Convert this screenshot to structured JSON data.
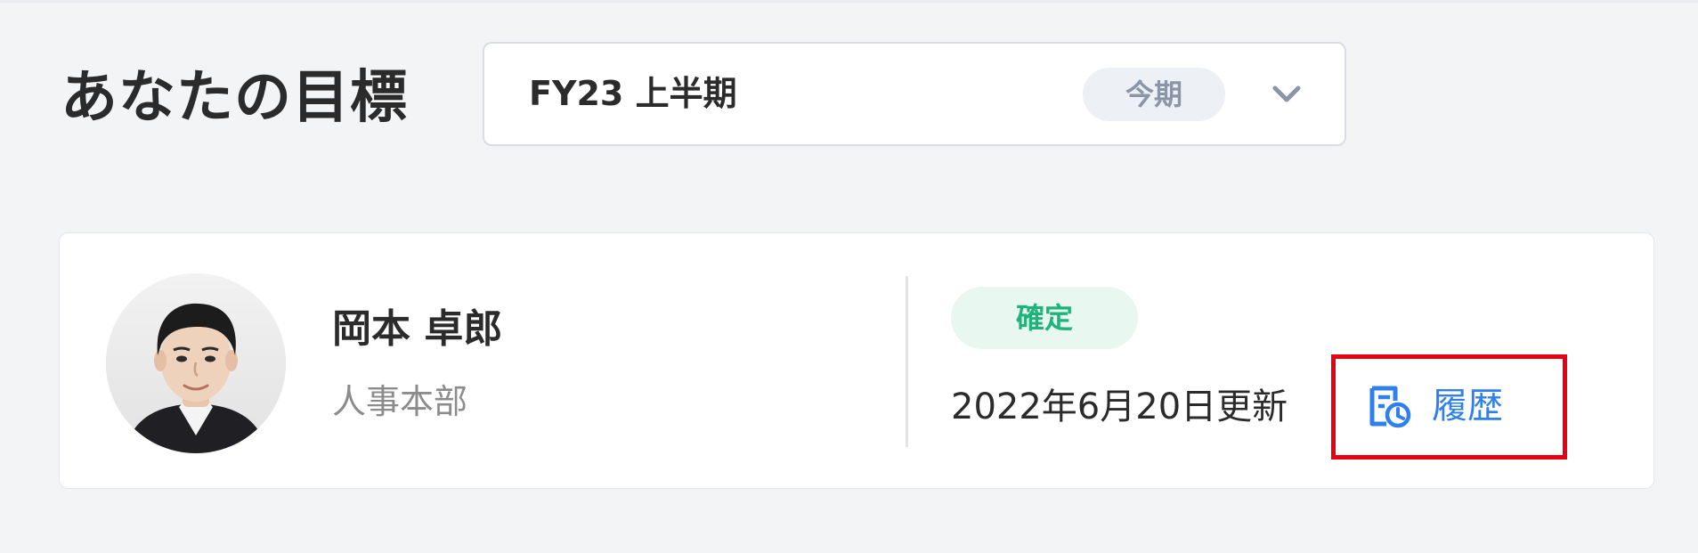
{
  "header": {
    "title": "あなたの目標",
    "period_select": {
      "selected_label": "FY23 上半期",
      "current_badge": "今期",
      "icon": "chevron-down-icon"
    }
  },
  "profile_card": {
    "avatar_icon": "user-avatar",
    "name": "岡本 卓郎",
    "department": "人事本部",
    "status": "確定",
    "status_color": "#1fb37b",
    "updated": "2022年6月20日更新",
    "history": {
      "label": "履歴",
      "icon": "history-icon",
      "color": "#2f80ed"
    }
  },
  "colors": {
    "highlight_border": "#e60012",
    "background": "#f3f4f6"
  }
}
